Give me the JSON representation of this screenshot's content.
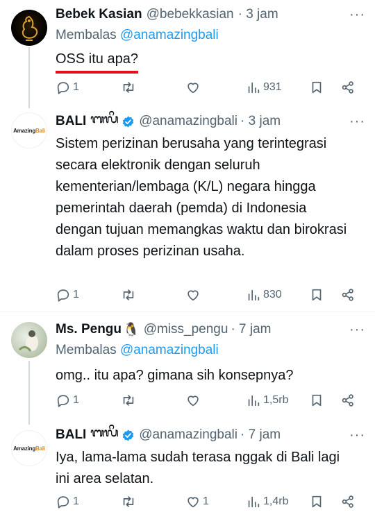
{
  "tweets": [
    {
      "name": "Bebek Kasian",
      "handle": "@bebekkasian",
      "time": "· 3 jam",
      "reply_prefix": "Membalas",
      "reply_handle": "@anamazingbali",
      "text": "OSS itu apa?",
      "replies": "1",
      "retweets": "",
      "likes": "",
      "views": "931"
    },
    {
      "name": "BALI",
      "name_script": "ᬩᬮᬶ",
      "handle": "@anamazingbali",
      "time": "· 3 jam",
      "text": "Sistem perizinan berusaha yang terintegrasi secara elektronik dengan seluruh kementerian/lembaga (K/L) negara hingga pemerintah daerah (pemda) di Indonesia dengan tujuan memangkas waktu dan birokrasi dalam proses perizinan usaha.",
      "replies": "1",
      "retweets": "",
      "likes": "",
      "views": "830"
    },
    {
      "name": "Ms. Pengu",
      "name_emoji": "🐧",
      "handle": "@miss_pengu",
      "time": "· 7 jam",
      "reply_prefix": "Membalas",
      "reply_handle": "@anamazingbali",
      "text": "omg.. itu apa? gimana sih konsepnya?",
      "replies": "1",
      "retweets": "",
      "likes": "",
      "views": "1,5rb"
    },
    {
      "name": "BALI",
      "name_script": "ᬩᬮᬶ",
      "handle": "@anamazingbali",
      "time": "· 7 jam",
      "text": "Iya, lama-lama sudah terasa nggak di Bali lagi ini area selatan.",
      "replies": "1",
      "retweets": "",
      "likes": "1",
      "views": "1,4rb"
    }
  ],
  "bali_logo": {
    "main": "Amazing",
    "accent": "Bali"
  },
  "more_glyph": "···",
  "colors": {
    "link": "#1d9bf0",
    "secondary": "#536471",
    "verified": "#1d9bf0",
    "underline": "#e0101c"
  },
  "icons": [
    "reply-icon",
    "retweet-icon",
    "like-icon",
    "views-icon",
    "bookmark-icon",
    "share-icon",
    "verified-icon",
    "more-icon"
  ]
}
